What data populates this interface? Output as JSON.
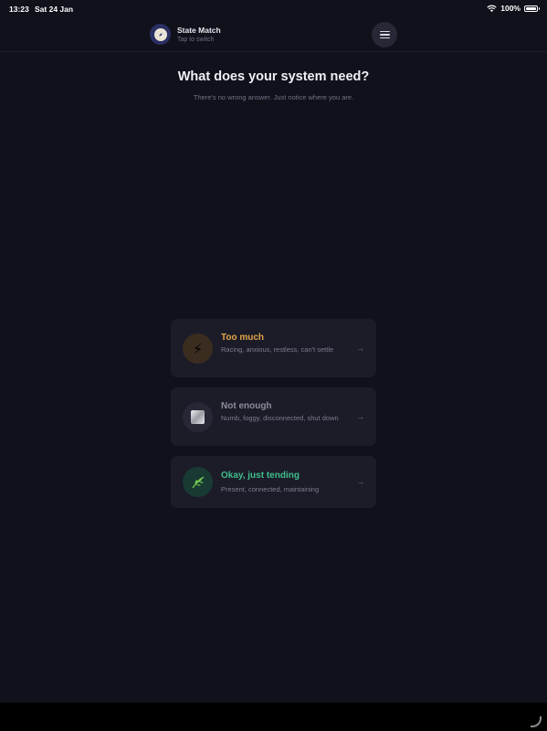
{
  "status_bar": {
    "time": "13:23",
    "date": "Sat 24 Jan",
    "battery": "100%"
  },
  "header": {
    "app_title": "State Match",
    "app_subtitle": "Tap to switch",
    "logo_icon": "compass-icon",
    "menu_icon": "hamburger-menu-icon"
  },
  "main": {
    "title": "What does your system need?",
    "subtitle": "There's no wrong answer. Just notice where you are."
  },
  "options": [
    {
      "title": "Too much",
      "description": "Racing, anxious, restless, can't settle",
      "icon": "lightning-icon",
      "glyph": "⚡",
      "title_color": "#e3a44a",
      "icon_bg": "#3a2d1f"
    },
    {
      "title": "Not enough",
      "description": "Numb, foggy, disconnected, shut down",
      "icon": "fog-icon",
      "glyph": "▦",
      "title_color": "#8b8d9b",
      "icon_bg": "#272836"
    },
    {
      "title": "Okay, just tending",
      "description": "Present, connected, maintaining",
      "icon": "leaf-icon",
      "glyph": "🌿",
      "title_color": "#3fbf8c",
      "icon_bg": "#183a33"
    }
  ],
  "arrow": "→"
}
